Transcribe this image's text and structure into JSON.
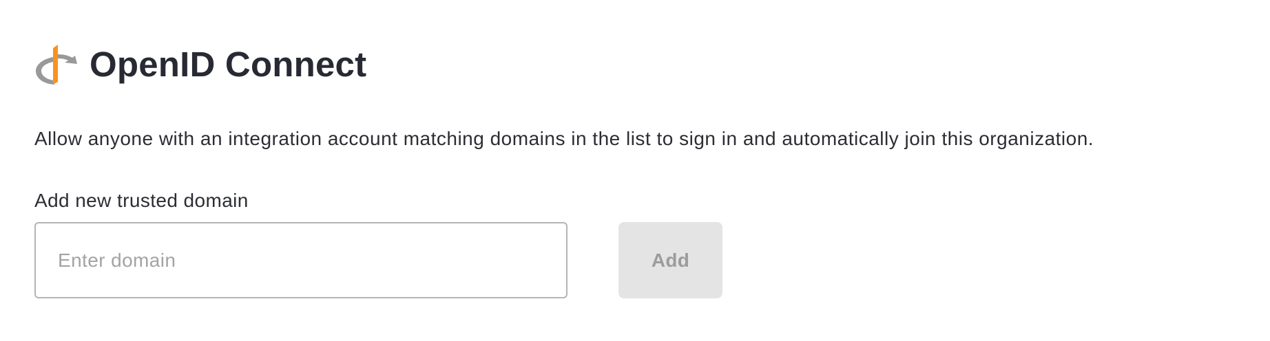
{
  "header": {
    "logo_icon": "openid-logo-icon",
    "title": "OpenID Connect"
  },
  "description": "Allow anyone with an integration account matching domains in the list to sign in and automatically join this organization.",
  "form": {
    "label": "Add new trusted domain",
    "input_value": "",
    "input_placeholder": "Enter domain",
    "add_label": "Add",
    "add_disabled": true
  },
  "colors": {
    "logo_orange": "#f7931e",
    "logo_gray": "#999999",
    "title": "#272a33",
    "text": "#2c2d33",
    "placeholder": "#a3a3a3",
    "input_border": "#b4b4b4",
    "button_disabled_bg": "#e4e4e4",
    "button_disabled_text": "#9c9c9c"
  }
}
